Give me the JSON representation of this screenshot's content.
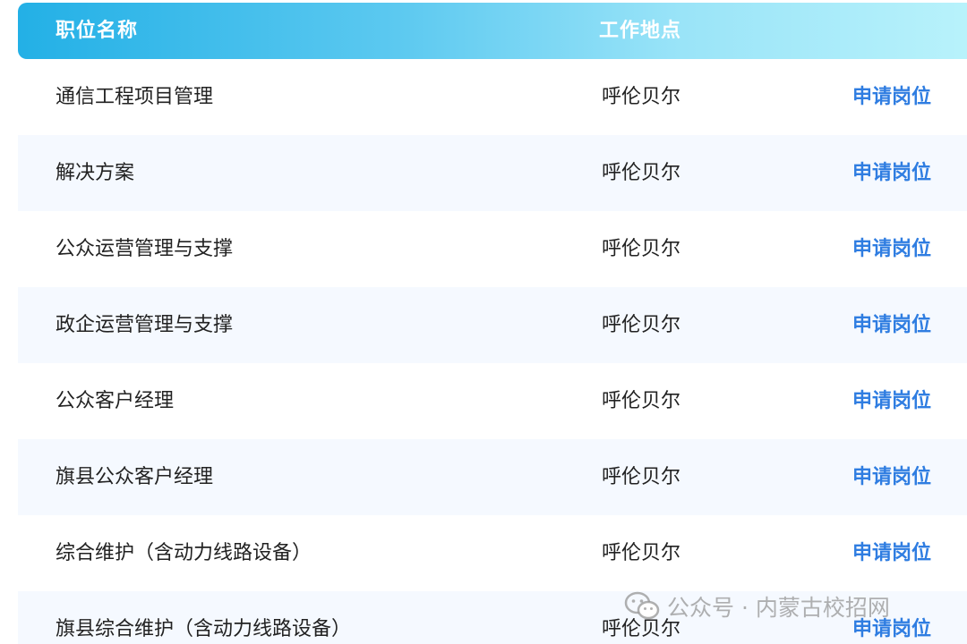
{
  "header": {
    "col_name": "职位名称",
    "col_location": "工作地点"
  },
  "rows": [
    {
      "name": "通信工程项目管理",
      "location": "呼伦贝尔",
      "action": "申请岗位"
    },
    {
      "name": "解决方案",
      "location": "呼伦贝尔",
      "action": "申请岗位"
    },
    {
      "name": "公众运营管理与支撑",
      "location": "呼伦贝尔",
      "action": "申请岗位"
    },
    {
      "name": "政企运营管理与支撑",
      "location": "呼伦贝尔",
      "action": "申请岗位"
    },
    {
      "name": "公众客户经理",
      "location": "呼伦贝尔",
      "action": "申请岗位"
    },
    {
      "name": "旗县公众客户经理",
      "location": "呼伦贝尔",
      "action": "申请岗位"
    },
    {
      "name": "综合维护（含动力线路设备）",
      "location": "呼伦贝尔",
      "action": "申请岗位"
    },
    {
      "name": "旗县综合维护（含动力线路设备）",
      "location": "呼伦贝尔",
      "action": "申请岗位"
    }
  ],
  "watermark": {
    "text": "公众号 · 内蒙古校招网",
    "icon": "wechat-icon"
  },
  "colors": {
    "header_gradient_start": "#23b0e6",
    "header_gradient_end": "#b8f2fb",
    "link": "#2f7de1",
    "row_alt": "#f5f9ff"
  }
}
